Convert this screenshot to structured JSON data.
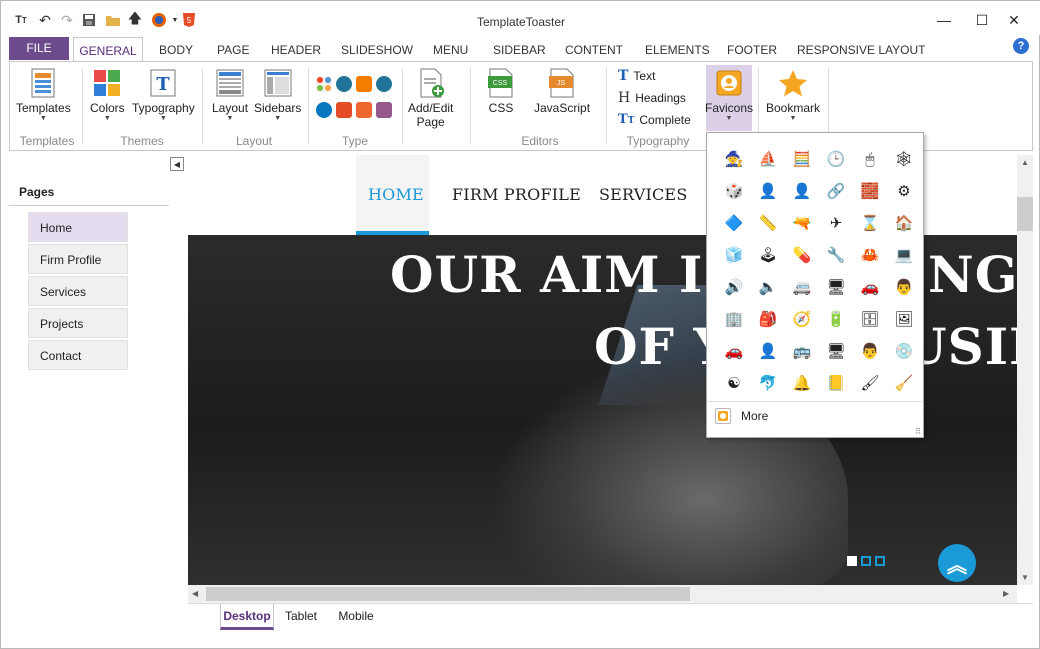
{
  "app": {
    "title": "TemplateToaster"
  },
  "ribbon_tabs": [
    "FILE",
    "GENERAL",
    "BODY",
    "PAGE",
    "HEADER",
    "SLIDESHOW",
    "MENU",
    "SIDEBAR",
    "CONTENT",
    "ELEMENTS",
    "FOOTER",
    "RESPONSIVE LAYOUT"
  ],
  "ribbon": {
    "templates": "Templates",
    "colors": "Colors",
    "typography": "Typography",
    "layout": "Layout",
    "sidebars": "Sidebars",
    "add_edit_page_line1": "Add/Edit",
    "add_edit_page_line2": "Page",
    "css": "CSS",
    "javascript": "JavaScript",
    "text": "Text",
    "headings": "Headings",
    "complete": "Complete",
    "favicons": "Favicons",
    "bookmark": "Bookmark",
    "groups": {
      "templates": "Templates",
      "themes": "Themes",
      "layout": "Layout",
      "type": "Type",
      "editors": "Editors",
      "typography": "Typography"
    },
    "icon_labels": {
      "css": "CSS",
      "js": "JS"
    }
  },
  "left_panel": {
    "title": "Pages",
    "pages": [
      "Home",
      "Firm Profile",
      "Services",
      "Projects",
      "Contact"
    ]
  },
  "canvas": {
    "nav": [
      "HOME",
      "FIRM PROFILE",
      "SERVICES"
    ],
    "hero_line1": "OUR AIM IS",
    "hero_line1_tail": "NG A",
    "hero_line2": "OF Y",
    "hero_line2_tail": "USIN"
  },
  "device_tabs": [
    "Desktop",
    "Tablet",
    "Mobile"
  ],
  "favicons_popup": {
    "icons": [
      "🧙",
      "⛵",
      "🧮",
      "🕒",
      "🖱",
      "🕸",
      "🎲",
      "👤",
      "👤",
      "🔗",
      "🧱",
      "⚙",
      "🔷",
      "📏",
      "🔫",
      "✈",
      "⌛",
      "🏠",
      "🧊",
      "🕹",
      "💊",
      "🔧",
      "🦀",
      "💻",
      "🔊",
      "🔈",
      "🚐",
      "🖥",
      "🚗",
      "👨",
      "🏢",
      "🎒",
      "🧭",
      "🔋",
      "🗄",
      "🖼",
      "🚗",
      "👤",
      "🚌",
      "🖥",
      "👨",
      "💿",
      "☯",
      "🐬",
      "🔔",
      "📒",
      "🖌",
      "🧹"
    ],
    "more_label": "More"
  },
  "accent": "#6d4a8c",
  "link_blue": "#1a9ad6"
}
